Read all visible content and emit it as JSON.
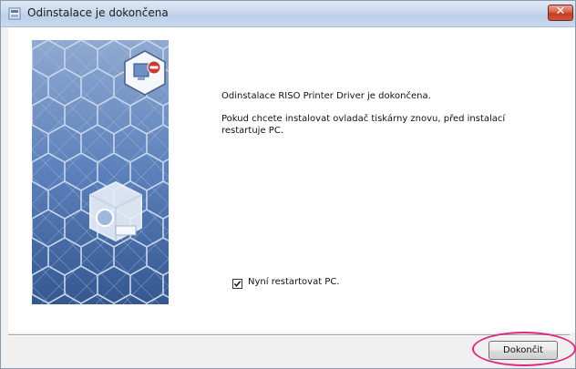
{
  "window": {
    "title": "Odinstalace je dokončena",
    "close_glyph": "✕"
  },
  "main": {
    "message": "Odinstalace RISO Printer Driver je dokončena.",
    "detail": "Pokud chcete instalovat ovladač tiskárny znovu, před instalací restartuje PC.",
    "restart_checkbox": {
      "label": "Nyní restartovat PC.",
      "checked": true
    }
  },
  "footer": {
    "finish_label": "Dokončit"
  },
  "colors": {
    "highlight": "#e0287e",
    "art_background": "#3f64a0"
  }
}
